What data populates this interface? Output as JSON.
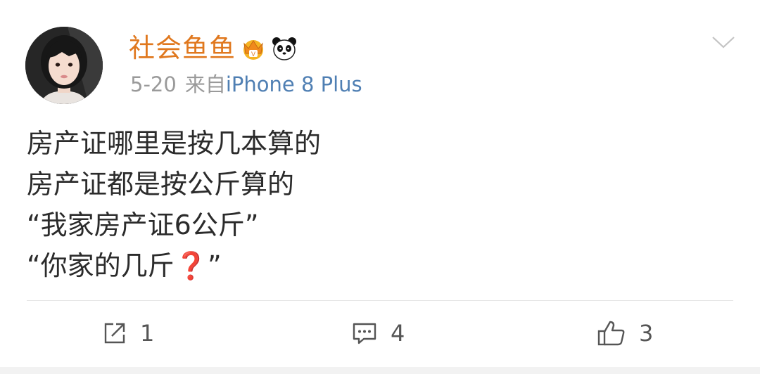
{
  "post": {
    "author": {
      "name": "社会鱼鱼",
      "avatar_icon": "user-avatar",
      "badges": [
        "crown-vip-badge-icon",
        "panda-icon"
      ]
    },
    "date": "5-20",
    "source_prefix": "来自",
    "source_device": "iPhone 8 Plus",
    "menu_icon": "chevron-down-icon",
    "lines": [
      "房产证哪里是按几本算的",
      "房产证都是按公斤算的",
      "“我家房产证6公斤”"
    ],
    "last_line_prefix": "“你家的几斤",
    "last_line_emoji": "❓",
    "last_line_suffix": "”"
  },
  "actions": {
    "repost": {
      "icon": "repost-icon",
      "count": "1"
    },
    "comment": {
      "icon": "comment-icon",
      "count": "4"
    },
    "like": {
      "icon": "thumbs-up-icon",
      "count": "3"
    }
  },
  "colors": {
    "username": "#e0781e",
    "device_link": "#4f7fb3",
    "meta_gray": "#9a9a9a",
    "body_text": "#2b2b2b",
    "question_mark": "#c9202a"
  }
}
